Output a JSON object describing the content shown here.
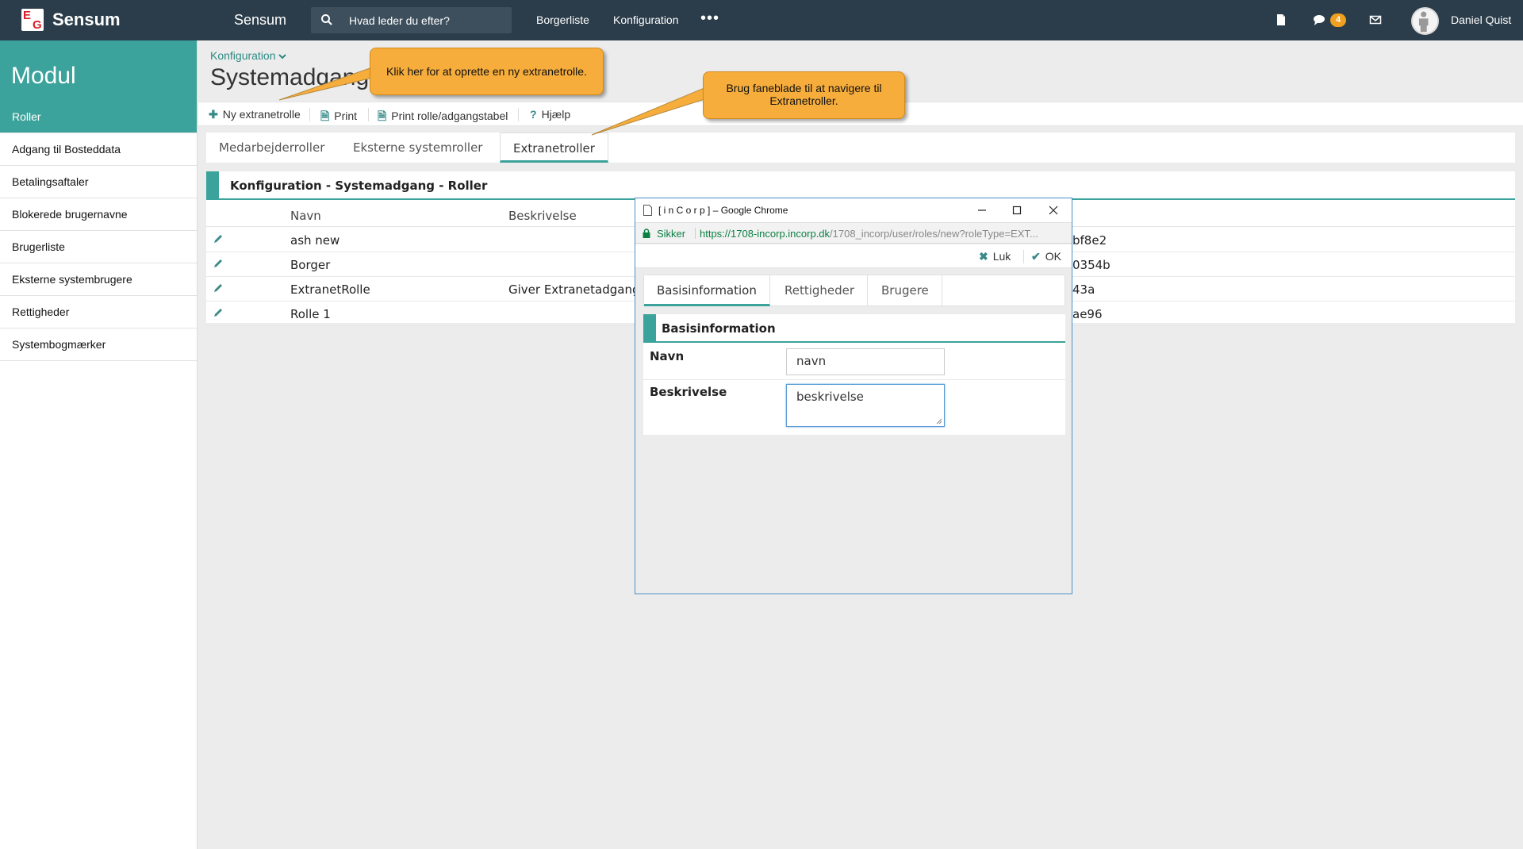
{
  "header": {
    "brand": "Sensum",
    "app_title": "Sensum",
    "search_placeholder": "Hvad leder du efter?",
    "nav": [
      "Borgerliste",
      "Konfiguration"
    ],
    "more": "•••",
    "messages_count": "4",
    "user_name": "Daniel Quist",
    "colors": {
      "bar": "#2b3d4a",
      "accent": "#3ba39b",
      "badge": "#f0a020"
    }
  },
  "sidebar": {
    "title": "Modul",
    "items": [
      {
        "label": "Roller",
        "active": true
      },
      {
        "label": "Adgang til Bosteddata"
      },
      {
        "label": "Betalingsaftaler"
      },
      {
        "label": "Blokerede brugernavne"
      },
      {
        "label": "Brugerliste"
      },
      {
        "label": "Eksterne systembrugere"
      },
      {
        "label": "Rettigheder"
      },
      {
        "label": "Systembogmærker"
      }
    ]
  },
  "main": {
    "breadcrumb": "Konfiguration",
    "title": "Systemadgang",
    "toolbar": {
      "new": "Ny extranetrolle",
      "print": "Print",
      "print_table": "Print rolle/adgangstabel",
      "help": "Hjælp"
    },
    "tabs": [
      "Medarbejderroller",
      "Eksterne systemroller",
      "Extranetroller"
    ],
    "active_tab": "Extranetroller",
    "panel_title": "Konfiguration - Systemadgang - Roller",
    "table": {
      "headers": [
        "Navn",
        "Beskrivelse"
      ],
      "rows": [
        {
          "name": "ash new",
          "description": "",
          "id_tail": "bf8e2"
        },
        {
          "name": "Borger",
          "description": "",
          "id_tail": "0354b"
        },
        {
          "name": "ExtranetRolle",
          "description": "Giver Extranetadgang.",
          "id_tail": "43a"
        },
        {
          "name": "Rolle 1",
          "description": "",
          "id_tail": "ae96"
        }
      ]
    }
  },
  "callouts": {
    "new_role": "Klik her for at oprette en ny extranetrolle.",
    "tabs_hint": "Brug faneblade til at navigere til Extranetroller."
  },
  "popup": {
    "window_title": "[ i n C o r p ] – Google Chrome",
    "secure_label": "Sikker",
    "url_main": "https://1708-incorp.incorp.dk",
    "url_rest": "/1708_incorp/user/roles/new?roleType=EXT...",
    "close_label": "Luk",
    "ok_label": "OK",
    "tabs": [
      "Basisinformation",
      "Rettigheder",
      "Brugere"
    ],
    "active_tab": "Basisinformation",
    "panel_title": "Basisinformation",
    "fields": {
      "name_label": "Navn",
      "name_value": "navn",
      "desc_label": "Beskrivelse",
      "desc_value": "beskrivelse"
    }
  }
}
